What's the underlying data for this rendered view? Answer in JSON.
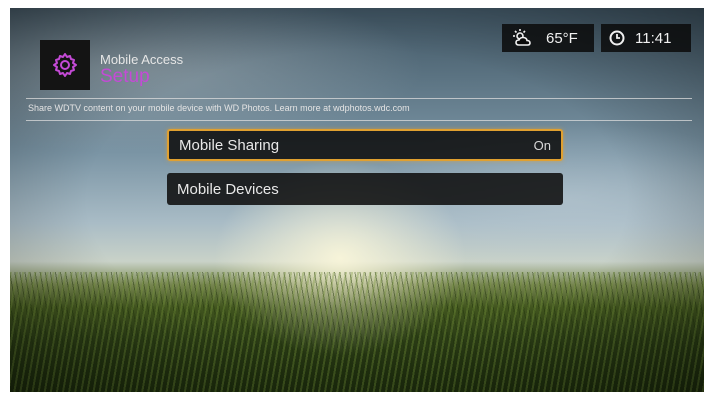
{
  "header": {
    "title": "Mobile Access",
    "subtitle": "Setup",
    "app_icon": "gear-icon"
  },
  "status": {
    "weather_icon": "partly-cloudy-icon",
    "temperature": "65°F",
    "clock_icon": "clock-icon",
    "time": "11:41"
  },
  "info": {
    "text": "Share WDTV content on your mobile device with WD Photos. Learn more at wdphotos.wdc.com"
  },
  "menu": {
    "items": [
      {
        "label": "Mobile Sharing",
        "value": "On",
        "selected": true
      },
      {
        "label": "Mobile Devices",
        "value": "",
        "selected": false
      }
    ]
  },
  "colors": {
    "accent": "#c44ad6",
    "selection_border": "#e0a030"
  }
}
